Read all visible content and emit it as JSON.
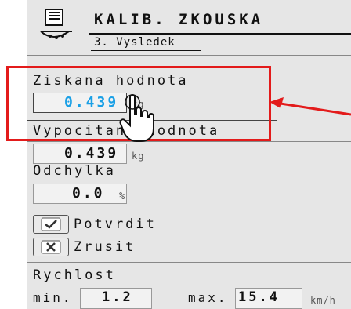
{
  "header": {
    "title": "KALIB. ZKOUSKA",
    "subtitle": "3. Vysledek",
    "icon": "scale-icon"
  },
  "obtained": {
    "label": "Ziskana hodnota",
    "value": "0.439",
    "unit": "kg"
  },
  "calculated": {
    "label": "Vypocitana hodnota",
    "value": "0.439",
    "unit": "kg"
  },
  "deviation": {
    "label": "Odchylka",
    "value": "0.0",
    "unit": "%"
  },
  "actions": {
    "confirm_label": "Potvrdit",
    "confirm_icon": "checkmark-icon",
    "cancel_label": "Zrusit",
    "cancel_icon": "x-icon"
  },
  "speed": {
    "label": "Rychlost",
    "min_label": "min.",
    "min_value": "1.2",
    "max_label": "max.",
    "max_value": "15.4",
    "unit": "km/h"
  },
  "colors": {
    "highlight": "#e31b1b",
    "value_active": "#1aa0e6"
  }
}
